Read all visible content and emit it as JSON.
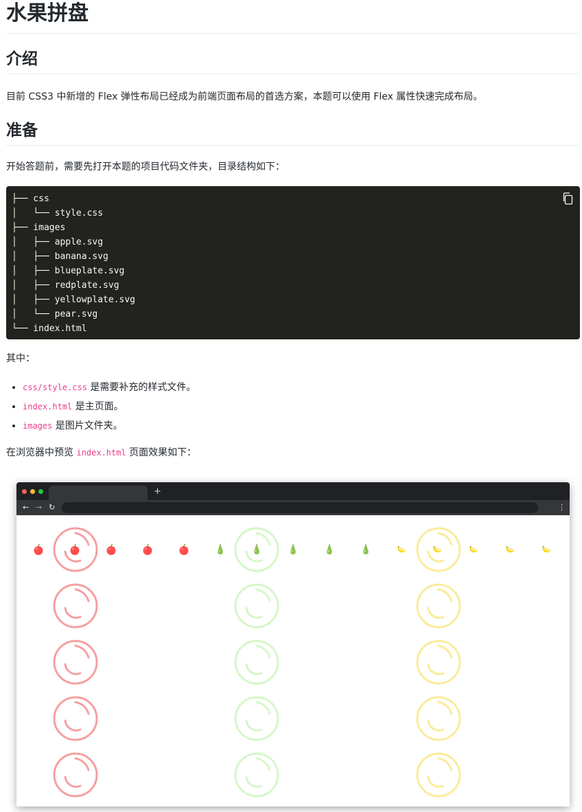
{
  "title": "水果拼盘",
  "intro": {
    "heading": "介绍",
    "text": "目前 CSS3 中新增的 Flex 弹性布局已经成为前端页面布局的首选方案，本题可以使用 Flex 属性快速完成布局。"
  },
  "prep": {
    "heading": "准备",
    "text": "开始答题前，需要先打开本题的项目代码文件夹，目录结构如下："
  },
  "code_block": {
    "content": "├── css\n│   └── style.css\n├── images\n│   ├── apple.svg\n│   ├── banana.svg\n│   ├── blueplate.svg\n│   ├── redplate.svg\n│   ├── yellowplate.svg\n│   └── pear.svg\n└── index.html",
    "copy_icon": "copy-icon"
  },
  "among": "其中：",
  "file_list": [
    {
      "code": "css/style.css",
      "desc": " 是需要补充的样式文件。"
    },
    {
      "code": "index.html",
      "desc": " 是主页面。"
    },
    {
      "code": "images",
      "desc": " 是图片文件夹。"
    }
  ],
  "preview": {
    "prefix": "在浏览器中预览 ",
    "code": "index.html",
    "suffix": " 页面效果如下："
  },
  "browser": {
    "new_tab": "+",
    "back": "←",
    "forward": "→",
    "reload": "↻",
    "menu": "⋮"
  },
  "fruit_row": [
    "apple",
    "apple",
    "apple",
    "apple",
    "apple",
    "pear",
    "pear",
    "pear",
    "pear",
    "pear",
    "banana",
    "banana",
    "banana",
    "banana",
    "banana"
  ],
  "plate_columns": [
    "redplate",
    "blueplate",
    "yellowplate"
  ],
  "plates_per_column": 5,
  "colors": {
    "apple": "#ff4d4f",
    "pear": "#8bc34a",
    "banana": "#fadb14",
    "redplate": "#f5a0a0",
    "blueplate": "#d4f7c8",
    "yellowplate": "#fbeb9a",
    "inline_code": "#e83e8c",
    "code_bg": "#22221e"
  }
}
